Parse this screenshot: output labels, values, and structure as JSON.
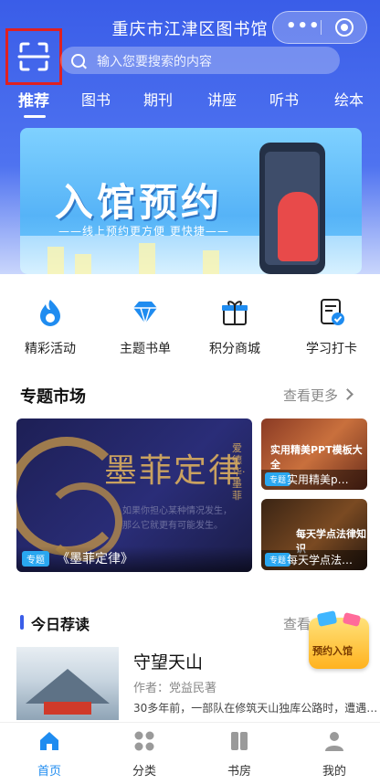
{
  "header": {
    "title": "重庆市江津区图书馆",
    "search_placeholder": "输入您要搜索的内容"
  },
  "tabs": [
    "推荐",
    "图书",
    "期刊",
    "讲座",
    "听书",
    "绘本"
  ],
  "banner": {
    "title": "入馆预约",
    "subtitle": "——线上预约更方便 更快捷——"
  },
  "quick_links": [
    {
      "label": "精彩活动",
      "icon": "flame-icon"
    },
    {
      "label": "主题书单",
      "icon": "diamond-icon"
    },
    {
      "label": "积分商城",
      "icon": "gift-icon"
    },
    {
      "label": "学习打卡",
      "icon": "checkin-icon"
    }
  ],
  "topics": {
    "title": "专题市场",
    "more": "查看更多",
    "main_card": {
      "tag": "专题",
      "caption": "《墨菲定律》",
      "cover_title": "墨菲定律",
      "cover_vertical": "爱德华·墨菲",
      "cover_lines": [
        "如果你担心某种情况发生，",
        "那么它就更有可能发生。"
      ]
    },
    "side_cards": [
      {
        "tag": "专题",
        "caption": "实用精美p…",
        "cover_title": "实用精美PPT模板大全"
      },
      {
        "tag": "专题",
        "caption": "每天学点法…",
        "cover_title": "每天学点法律知识"
      }
    ]
  },
  "today": {
    "title": "今日荐读",
    "more": "查看",
    "book": {
      "title": "守望天山",
      "author": "作者：党益民著",
      "desc": "30多年前，一部队在修筑天山独库公路时，遭遇…"
    }
  },
  "floating_badge": {
    "label": "预约入馆"
  },
  "bottom_nav": [
    {
      "label": "首页",
      "icon": "home-icon",
      "active": true
    },
    {
      "label": "分类",
      "icon": "category-icon",
      "active": false
    },
    {
      "label": "书房",
      "icon": "bookshelf-icon",
      "active": false
    },
    {
      "label": "我的",
      "icon": "user-icon",
      "active": false
    }
  ],
  "colors": {
    "brand_blue": "#3a5de8",
    "active_tab": "#1f8cf0",
    "highlight_box": "#e02020"
  }
}
